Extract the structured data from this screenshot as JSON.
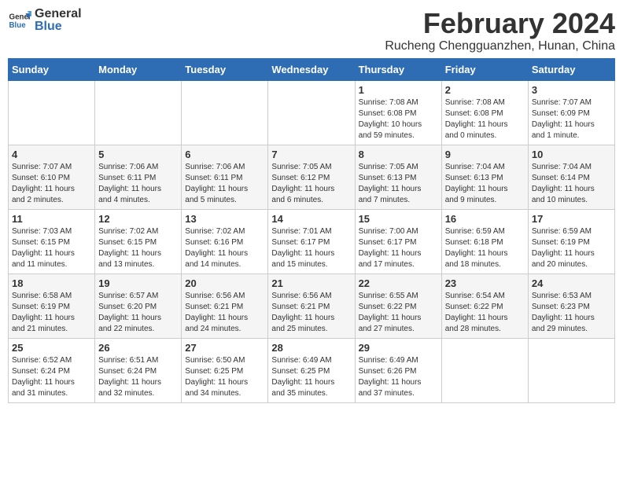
{
  "header": {
    "logo_general": "General",
    "logo_blue": "Blue",
    "main_title": "February 2024",
    "subtitle": "Rucheng Chengguanzhen, Hunan, China"
  },
  "days_of_week": [
    "Sunday",
    "Monday",
    "Tuesday",
    "Wednesday",
    "Thursday",
    "Friday",
    "Saturday"
  ],
  "weeks": [
    [
      {
        "day": "",
        "info": ""
      },
      {
        "day": "",
        "info": ""
      },
      {
        "day": "",
        "info": ""
      },
      {
        "day": "",
        "info": ""
      },
      {
        "day": "1",
        "info": "Sunrise: 7:08 AM\nSunset: 6:08 PM\nDaylight: 10 hours\nand 59 minutes."
      },
      {
        "day": "2",
        "info": "Sunrise: 7:08 AM\nSunset: 6:08 PM\nDaylight: 11 hours\nand 0 minutes."
      },
      {
        "day": "3",
        "info": "Sunrise: 7:07 AM\nSunset: 6:09 PM\nDaylight: 11 hours\nand 1 minute."
      }
    ],
    [
      {
        "day": "4",
        "info": "Sunrise: 7:07 AM\nSunset: 6:10 PM\nDaylight: 11 hours\nand 2 minutes."
      },
      {
        "day": "5",
        "info": "Sunrise: 7:06 AM\nSunset: 6:11 PM\nDaylight: 11 hours\nand 4 minutes."
      },
      {
        "day": "6",
        "info": "Sunrise: 7:06 AM\nSunset: 6:11 PM\nDaylight: 11 hours\nand 5 minutes."
      },
      {
        "day": "7",
        "info": "Sunrise: 7:05 AM\nSunset: 6:12 PM\nDaylight: 11 hours\nand 6 minutes."
      },
      {
        "day": "8",
        "info": "Sunrise: 7:05 AM\nSunset: 6:13 PM\nDaylight: 11 hours\nand 7 minutes."
      },
      {
        "day": "9",
        "info": "Sunrise: 7:04 AM\nSunset: 6:13 PM\nDaylight: 11 hours\nand 9 minutes."
      },
      {
        "day": "10",
        "info": "Sunrise: 7:04 AM\nSunset: 6:14 PM\nDaylight: 11 hours\nand 10 minutes."
      }
    ],
    [
      {
        "day": "11",
        "info": "Sunrise: 7:03 AM\nSunset: 6:15 PM\nDaylight: 11 hours\nand 11 minutes."
      },
      {
        "day": "12",
        "info": "Sunrise: 7:02 AM\nSunset: 6:15 PM\nDaylight: 11 hours\nand 13 minutes."
      },
      {
        "day": "13",
        "info": "Sunrise: 7:02 AM\nSunset: 6:16 PM\nDaylight: 11 hours\nand 14 minutes."
      },
      {
        "day": "14",
        "info": "Sunrise: 7:01 AM\nSunset: 6:17 PM\nDaylight: 11 hours\nand 15 minutes."
      },
      {
        "day": "15",
        "info": "Sunrise: 7:00 AM\nSunset: 6:17 PM\nDaylight: 11 hours\nand 17 minutes."
      },
      {
        "day": "16",
        "info": "Sunrise: 6:59 AM\nSunset: 6:18 PM\nDaylight: 11 hours\nand 18 minutes."
      },
      {
        "day": "17",
        "info": "Sunrise: 6:59 AM\nSunset: 6:19 PM\nDaylight: 11 hours\nand 20 minutes."
      }
    ],
    [
      {
        "day": "18",
        "info": "Sunrise: 6:58 AM\nSunset: 6:19 PM\nDaylight: 11 hours\nand 21 minutes."
      },
      {
        "day": "19",
        "info": "Sunrise: 6:57 AM\nSunset: 6:20 PM\nDaylight: 11 hours\nand 22 minutes."
      },
      {
        "day": "20",
        "info": "Sunrise: 6:56 AM\nSunset: 6:21 PM\nDaylight: 11 hours\nand 24 minutes."
      },
      {
        "day": "21",
        "info": "Sunrise: 6:56 AM\nSunset: 6:21 PM\nDaylight: 11 hours\nand 25 minutes."
      },
      {
        "day": "22",
        "info": "Sunrise: 6:55 AM\nSunset: 6:22 PM\nDaylight: 11 hours\nand 27 minutes."
      },
      {
        "day": "23",
        "info": "Sunrise: 6:54 AM\nSunset: 6:22 PM\nDaylight: 11 hours\nand 28 minutes."
      },
      {
        "day": "24",
        "info": "Sunrise: 6:53 AM\nSunset: 6:23 PM\nDaylight: 11 hours\nand 29 minutes."
      }
    ],
    [
      {
        "day": "25",
        "info": "Sunrise: 6:52 AM\nSunset: 6:24 PM\nDaylight: 11 hours\nand 31 minutes."
      },
      {
        "day": "26",
        "info": "Sunrise: 6:51 AM\nSunset: 6:24 PM\nDaylight: 11 hours\nand 32 minutes."
      },
      {
        "day": "27",
        "info": "Sunrise: 6:50 AM\nSunset: 6:25 PM\nDaylight: 11 hours\nand 34 minutes."
      },
      {
        "day": "28",
        "info": "Sunrise: 6:49 AM\nSunset: 6:25 PM\nDaylight: 11 hours\nand 35 minutes."
      },
      {
        "day": "29",
        "info": "Sunrise: 6:49 AM\nSunset: 6:26 PM\nDaylight: 11 hours\nand 37 minutes."
      },
      {
        "day": "",
        "info": ""
      },
      {
        "day": "",
        "info": ""
      }
    ]
  ]
}
